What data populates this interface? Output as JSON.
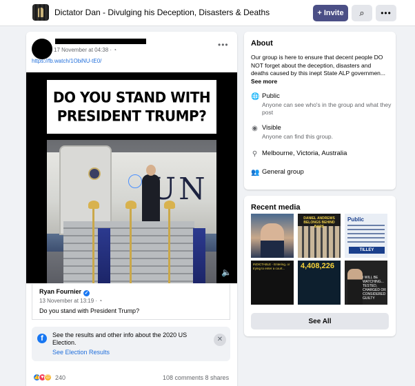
{
  "header": {
    "group_name": "Dictator Dan - Divulging his Deception, Disasters & Deaths",
    "invite_label": "Invite",
    "invite_icon": "+",
    "search_icon": "⌕",
    "more_icon": "•••"
  },
  "post": {
    "timestamp": "17 November at 04:38 · ",
    "link": "https://fb.watch/1ObiNU-tE0/",
    "video_caption_line1": "DO YOU STAND WITH",
    "video_caption_line2": "PRESIDENT TRUMP?",
    "video_bg_text": "UN",
    "shared": {
      "author": "Ryan Fournier",
      "timestamp": "13 November at 13:19 · ",
      "text": "Do you stand with President Trump?"
    },
    "election_notice": {
      "text": "See the results and other info about the 2020 US Election.",
      "link_label": "See Election Results"
    },
    "reaction_count": "240",
    "comments": "108 comments",
    "shares": "8 shares"
  },
  "about": {
    "title": "About",
    "description": "Our group is here to ensure that decent people DO NOT forget about the deception, disasters and deaths caused by this inept State ALP governmen...",
    "see_more": "See more",
    "items": [
      {
        "icon": "globe-icon",
        "title": "Public",
        "subtitle": "Anyone can see who's in the group and what they post"
      },
      {
        "icon": "eye-icon",
        "title": "Visible",
        "subtitle": "Anyone can find this group."
      },
      {
        "icon": "location-pin-icon",
        "title": "Melbourne, Victoria, Australia",
        "subtitle": ""
      },
      {
        "icon": "group-icon",
        "title": "General group",
        "subtitle": ""
      }
    ]
  },
  "recent_media": {
    "title": "Recent media",
    "see_all": "See All",
    "thumbs": [
      {
        "text": ""
      },
      {
        "text": "DANIEL ANDREWS BELONGS BEHIND BARS"
      },
      {
        "text": "Public",
        "badge": "TILLEY"
      },
      {
        "text": "INDICTABLE - Entering, or trying to enter a court..."
      },
      {
        "text": "4,408,226"
      },
      {
        "text": "I WILL BE WATCHING... TESTED, CHARGED OR CONSIDERED GUILTY"
      }
    ]
  },
  "colors": {
    "invite_bg": "#4b4f86",
    "link": "#216fdb",
    "facebook_blue": "#1877f2"
  }
}
